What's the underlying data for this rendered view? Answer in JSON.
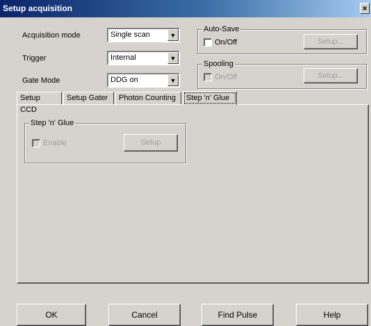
{
  "window": {
    "title": "Setup acquisition",
    "close_glyph": "×"
  },
  "settings": {
    "acquisition_mode": {
      "label": "Acquisition mode",
      "value": "Single scan"
    },
    "trigger": {
      "label": "Trigger",
      "value": "Internal"
    },
    "gate_mode": {
      "label": "Gate Mode",
      "value": "DDG on"
    }
  },
  "auto_save": {
    "title": "Auto-Save",
    "checkbox_label": "On/Off",
    "setup_label": "Setup...",
    "checked": false,
    "enabled": true,
    "setup_enabled": false
  },
  "spooling": {
    "title": "Spooling",
    "checkbox_label": "On/Off",
    "setup_label": "Setup...",
    "checked": false,
    "enabled": false
  },
  "tabs": [
    {
      "label": "Setup CCD",
      "active": false
    },
    {
      "label": "Setup Gater",
      "active": false
    },
    {
      "label": "Photon Counting",
      "active": false
    },
    {
      "label": "Step 'n' Glue",
      "active": true
    }
  ],
  "step_n_glue": {
    "title": "Step 'n' Glue",
    "enable_label": "Enable",
    "setup_label": "Setup",
    "enabled": false
  },
  "buttons": {
    "ok": "OK",
    "cancel": "Cancel",
    "find_pulse": "Find Pulse",
    "help": "Help"
  },
  "icons": {
    "dropdown": "dropdown-arrow-icon",
    "close": "close-icon",
    "checkbox": "checkbox-icon"
  },
  "colors": {
    "face": "#d6d3ce",
    "title_start": "#0a246a",
    "title_end": "#a6caf0",
    "disabled_text": "#a0a0a0"
  }
}
